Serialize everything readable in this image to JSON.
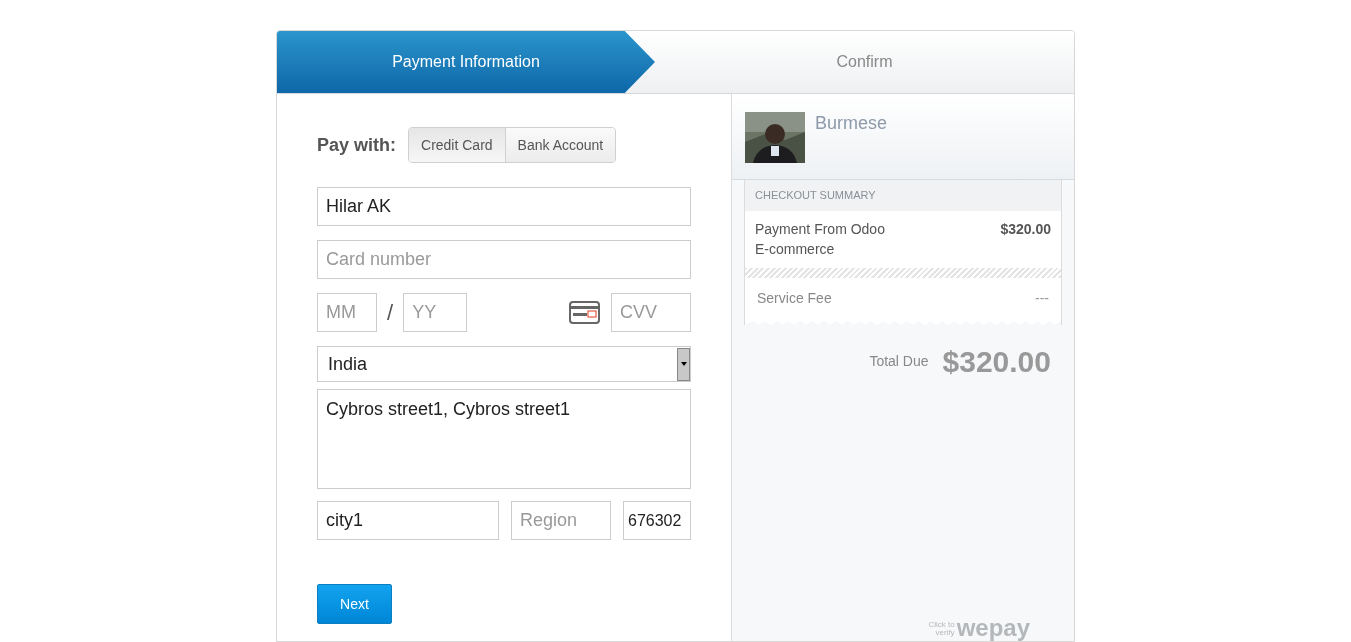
{
  "steps": [
    {
      "label": "Payment Information",
      "selected": true
    },
    {
      "label": "Confirm",
      "selected": false
    }
  ],
  "pay_with": {
    "label": "Pay with:",
    "options": [
      {
        "label": "Credit Card",
        "selected": true
      },
      {
        "label": "Bank Account",
        "selected": false
      }
    ]
  },
  "form": {
    "name": {
      "value": "Hilar AK"
    },
    "card_number": {
      "placeholder": "Card number"
    },
    "month": {
      "placeholder": "MM"
    },
    "separator": "/",
    "year": {
      "placeholder": "YY"
    },
    "cvv": {
      "placeholder": "CVV"
    },
    "country": {
      "value": "India"
    },
    "address": {
      "value": "Cybros street1, Cybros street1"
    },
    "city": {
      "value": "city1"
    },
    "region": {
      "placeholder": "Region"
    },
    "zip": {
      "value": "676302"
    }
  },
  "next_button": "Next",
  "merchant": {
    "name": "Burmese"
  },
  "summary": {
    "title": "CHECKOUT SUMMARY",
    "item": {
      "description": "Payment From Odoo E-commerce",
      "amount": "$320.00"
    },
    "fee": {
      "label": "Service Fee",
      "amount": "---"
    },
    "total_label": "Total Due",
    "total": "$320.00"
  },
  "badge": {
    "line_1": "Click to",
    "line_2": "verify",
    "logo": "wepay"
  }
}
